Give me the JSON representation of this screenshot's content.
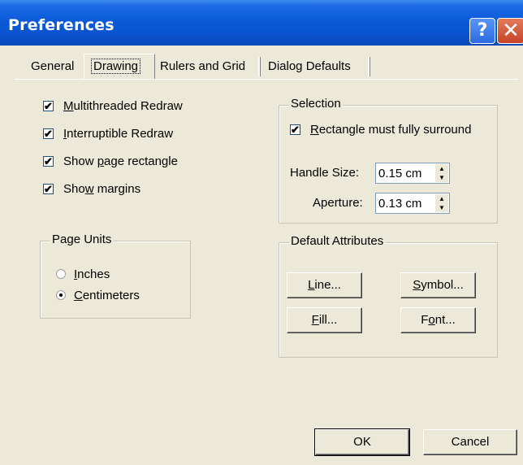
{
  "dialog": {
    "title": "Preferences",
    "help_glyph": "?",
    "close_glyph": "✕"
  },
  "tabs": [
    {
      "label": "General"
    },
    {
      "label": "Drawing",
      "active": true
    },
    {
      "label": "Rulers and Grid"
    },
    {
      "label": "Dialog Defaults"
    }
  ],
  "options": [
    {
      "pre": "",
      "key": "M",
      "post": "ultithreaded Redraw",
      "checked": true
    },
    {
      "pre": "",
      "key": "I",
      "post": "nterruptible Redraw",
      "checked": true
    },
    {
      "pre": "Show ",
      "key": "p",
      "post": "age rectangle",
      "checked": true
    },
    {
      "pre": "Sho",
      "key": "w",
      "post": " margins",
      "checked": true
    }
  ],
  "page_units": {
    "title": "Page Units",
    "options": [
      {
        "pre": "",
        "key": "I",
        "post": "nches",
        "selected": false
      },
      {
        "pre": "",
        "key": "C",
        "post": "entimeters",
        "selected": true
      }
    ]
  },
  "selection": {
    "title": "Selection",
    "rect_pre": "",
    "rect_key": "R",
    "rect_post": "ectangle must fully surround",
    "rect_checked": true,
    "handle_size_label": "Handle Size:",
    "handle_size_value": "0.15 cm",
    "aperture_label": "Aperture:",
    "aperture_value": "0.13 cm"
  },
  "default_attributes": {
    "title": "Default Attributes",
    "line": {
      "pre": "",
      "key": "L",
      "post": "ine..."
    },
    "symbol": {
      "pre": "",
      "key": "S",
      "post": "ymbol..."
    },
    "fill": {
      "pre": "",
      "key": "F",
      "post": "ill..."
    },
    "font": {
      "pre": "F",
      "key": "o",
      "post": "nt..."
    }
  },
  "footer": {
    "ok_label": "OK",
    "cancel_label": "Cancel"
  },
  "icons": {
    "check": "✔",
    "spin_up": "▲",
    "spin_down": "▼"
  },
  "colors": {
    "titlebar": "#0A5AD8",
    "dialog_bg": "#ECE9D8",
    "close": "#C6432A"
  }
}
